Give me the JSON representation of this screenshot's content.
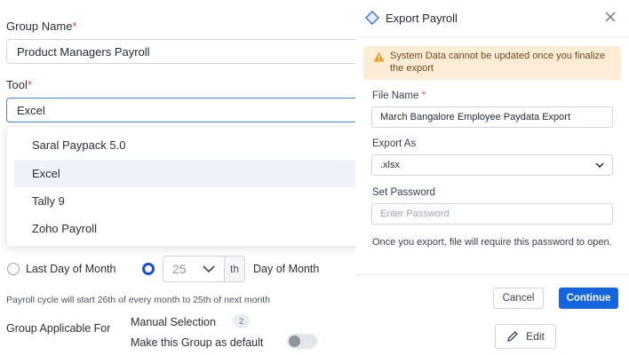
{
  "form": {
    "group_name_label": "Group Name",
    "required_mark": "*",
    "group_name_value": "Product Managers Payroll",
    "tool_label": "Tool",
    "tool_value": "Excel",
    "tool_options": [
      "Saral Paypack 5.0",
      "Excel",
      "Tally 9",
      "Zoho Payroll"
    ],
    "last_day_label": "Last Day of Month",
    "day_value": "25",
    "day_suffix": "th",
    "day_of_month_label": "Day of Month",
    "cycle_note": "Payroll cycle will start 26th of every month to 25th of next month",
    "applicable_label": "Group Applicable For",
    "manual_selection_label": "Manual Selection",
    "manual_selection_count": "2",
    "default_label": "Make this Group as default",
    "default_on": false
  },
  "modal": {
    "title": "Export Payroll",
    "warning": "System Data cannot be updated once you finalize the export",
    "file_name_label": "File Name",
    "required_mark": "*",
    "file_name_value": "March Bangalore Employee Paydata Export",
    "export_as_label": "Export As",
    "export_as_value": ".xlsx",
    "password_label": "Set Password",
    "password_placeholder": "Enter Password",
    "info": "Once you export, file will require this password to open.",
    "cancel_label": "Cancel",
    "continue_label": "Continue",
    "edit_label": "Edit"
  },
  "colors": {
    "primary": "#1565e0",
    "warning_bg": "#fdecd6",
    "warning_icon": "#f0a020",
    "required": "#e5484d"
  }
}
